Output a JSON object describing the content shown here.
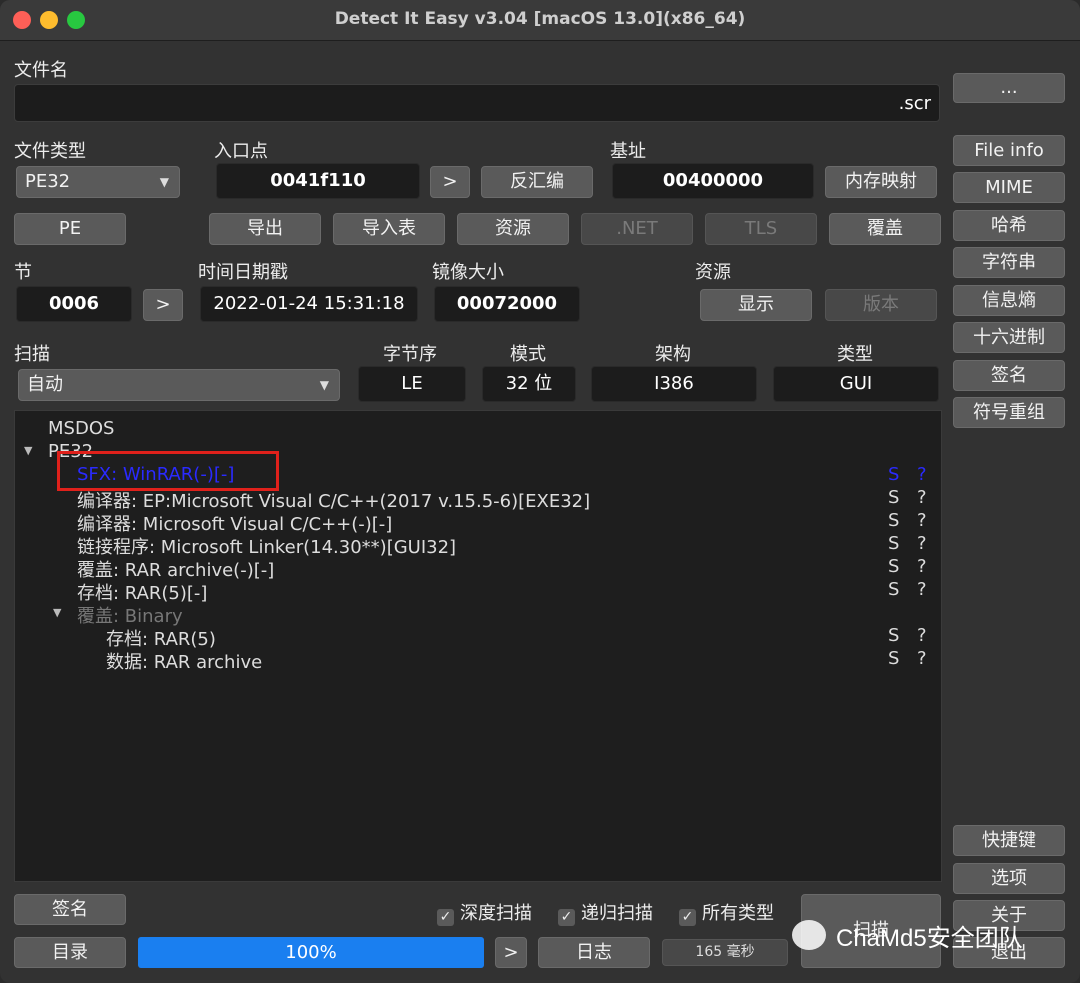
{
  "window": {
    "title": "Detect It Easy v3.04 [macOS 13.0](x86_64)",
    "traffic_lights": [
      "#fe5f57",
      "#febc2e",
      "#28c840"
    ]
  },
  "file": {
    "label": "文件名",
    "value": ".scr"
  },
  "filetype": {
    "label": "文件类型",
    "value": "PE32"
  },
  "entry": {
    "label": "入口点",
    "value": "0041f110",
    "next": ">",
    "disasm": "反汇编"
  },
  "base": {
    "label": "基址",
    "value": "00400000",
    "memmap": "内存映射"
  },
  "row_buttons": {
    "pe": "PE",
    "export": "导出",
    "import": "导入表",
    "resources": "资源",
    "net": ".NET",
    "tls": "TLS",
    "overlay": "覆盖"
  },
  "section": {
    "label": "节",
    "value": "0006",
    "next": ">"
  },
  "timestamp": {
    "label": "时间日期戳",
    "value": "2022-01-24 15:31:18"
  },
  "image_size": {
    "label": "镜像大小",
    "value": "00072000"
  },
  "res": {
    "label": "资源",
    "show": "显示",
    "version": "版本"
  },
  "scan": {
    "label": "扫描",
    "mode": "自动",
    "endian_label": "字节序",
    "endian": "LE",
    "mode_label": "模式",
    "bits": "32 位",
    "arch_label": "架构",
    "arch": "I386",
    "type_label": "类型",
    "type": "GUI"
  },
  "tree": {
    "msdos": "MSDOS",
    "pe32": "PE32",
    "sfx": "SFX: WinRAR(-)[-]",
    "items": [
      "编译器: EP:Microsoft Visual C/C++(2017 v.15.5-6)[EXE32]",
      "编译器: Microsoft Visual C/C++(-)[-]",
      "链接程序: Microsoft Linker(14.30**)[GUI32]",
      "覆盖: RAR archive(-)[-]",
      "存档: RAR(5)[-]"
    ],
    "overlay_node": "覆盖: Binary",
    "overlay_items": [
      "存档: RAR(5)",
      "数据: RAR archive"
    ],
    "s": "S",
    "q": "?"
  },
  "side": {
    "more": "...",
    "items": [
      "File info",
      "MIME",
      "哈希",
      "字符串",
      "信息熵",
      "十六进制",
      "签名",
      "符号重组"
    ],
    "hotkeys": "快捷键",
    "options": "选项",
    "about": "关于",
    "exit": "退出"
  },
  "bottom": {
    "signatures": "签名",
    "deep": "深度扫描",
    "recursive": "递归扫描",
    "alltypes": "所有类型",
    "scan_btn": "扫描",
    "dir": "目录",
    "progress_label": "100%",
    "progress_value": 1.0,
    "next": ">",
    "log": "日志",
    "time": "165 毫秒",
    "check": "✓"
  },
  "watermark": {
    "text": "ChaMd5安全团队"
  }
}
